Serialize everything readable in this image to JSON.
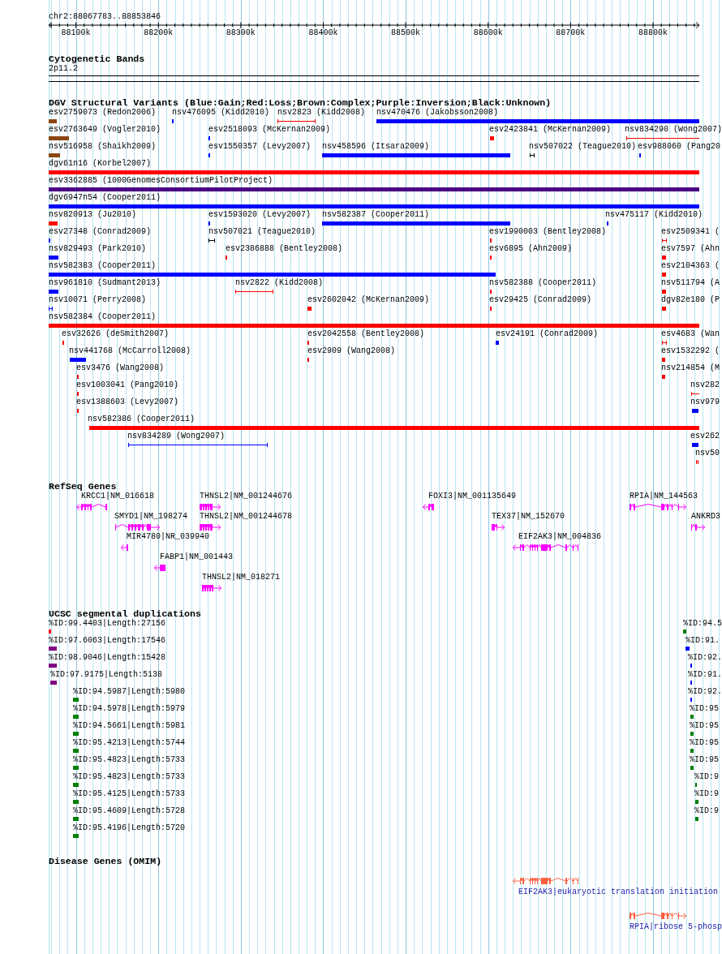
{
  "ruler": {
    "region": "chr2:88067783..88853846",
    "ticks": [
      "88100k",
      "88200k",
      "88300k",
      "88400k",
      "88500k",
      "88600k",
      "88700k",
      "88800k"
    ]
  },
  "tracks": [
    {
      "kind": "cytoband",
      "title": "Cytogenetic Bands",
      "bands": [
        {
          "label": "2p11.2"
        }
      ]
    },
    {
      "kind": "variants",
      "title": "DGV Structural Variants (Blue:Gain;Red:Loss;Brown:Complex;Purple:Inversion;Black:Unknown)",
      "features": [
        {
          "label": "esv2759073 (Redon2006)",
          "kind": "bar",
          "color": "#8b4513"
        },
        {
          "label": "nsv476095 (Kidd2010)",
          "kind": "bar",
          "color": "#0000ff"
        },
        {
          "label": "nsv2823 (Kidd2008)",
          "kind": "span",
          "color": "#ff0000"
        },
        {
          "label": "nsv470476 (Jakobsson2008)",
          "kind": "bar",
          "color": "#0000ff"
        },
        {
          "label": "esv2763649 (Vogler2010)",
          "kind": "bar",
          "color": "#8b4513"
        },
        {
          "label": "esv2518093 (McKernan2009)",
          "kind": "bar",
          "color": "#0000ff"
        },
        {
          "label": "esv2423841 (McKernan2009)",
          "kind": "bar",
          "color": "#ff0000"
        },
        {
          "label": "nsv834290 (Wong2007)",
          "kind": "span",
          "color": "#ff0000"
        },
        {
          "label": "nsv516958 (Shaikh2009)",
          "kind": "bar",
          "color": "#8b4513"
        },
        {
          "label": "esv1550357 (Levy2007)",
          "kind": "bar",
          "color": "#0000ff"
        },
        {
          "label": "nsv458596 (Itsara2009)",
          "kind": "bar",
          "color": "#0000ff"
        },
        {
          "label": "nsv507022 (Teague2010)",
          "kind": "span",
          "color": "#000000"
        },
        {
          "label": "esv988060 (Pang20",
          "kind": "bar",
          "color": "#0000ff"
        },
        {
          "label": "dgv61n16 (Korbel2007)",
          "kind": "bar",
          "color": "#ff0000"
        },
        {
          "label": "esv3362885 (1000GenomesConsortiumPilotProject)",
          "kind": "bar",
          "color": "#4b0082"
        },
        {
          "label": "dgv6947n54 (Cooper2011)",
          "kind": "bar",
          "color": "#0000ff"
        },
        {
          "label": "nsv820913 (Ju2010)",
          "kind": "bar",
          "color": "#ff0000"
        },
        {
          "label": "esv1593020 (Levy2007)",
          "kind": "bar",
          "color": "#0000ff"
        },
        {
          "label": "nsv582387 (Cooper2011)",
          "kind": "bar",
          "color": "#0000ff"
        },
        {
          "label": "nsv475117 (Kidd2010)",
          "kind": "bar",
          "color": "#0000ff"
        },
        {
          "label": "esv27348 (Conrad2009)",
          "kind": "bar",
          "color": "#0000ff"
        },
        {
          "label": "nsv507021 (Teague2010)",
          "kind": "span",
          "color": "#000000"
        },
        {
          "label": "esv1990003 (Bentley2008)",
          "kind": "bar",
          "color": "#ff0000"
        },
        {
          "label": "esv2509341 (",
          "kind": "span",
          "color": "#ff0000"
        },
        {
          "label": "nsv829493 (Park2010)",
          "kind": "bar",
          "color": "#0000ff"
        },
        {
          "label": "esv2386888 (Bentley2008)",
          "kind": "bar",
          "color": "#ff0000"
        },
        {
          "label": "esv6895 (Ahn2009)",
          "kind": "bar",
          "color": "#ff0000"
        },
        {
          "label": "esv7597 (Ahn",
          "kind": "bar",
          "color": "#ff0000"
        },
        {
          "label": "nsv582383 (Cooper2011)",
          "kind": "bar",
          "color": "#0000ff"
        },
        {
          "label": "esv2104363 (",
          "kind": "bar",
          "color": "#ff0000"
        },
        {
          "label": "nsv961810 (Sudmant2013)",
          "kind": "bar",
          "color": "#0000ff"
        },
        {
          "label": "nsv2822 (Kidd2008)",
          "kind": "span",
          "color": "#ff0000"
        },
        {
          "label": "nsv582388 (Cooper2011)",
          "kind": "bar",
          "color": "#ff0000"
        },
        {
          "label": "nsv511794 (A",
          "kind": "bar",
          "color": "#ff0000"
        },
        {
          "label": "nsv10071 (Perry2008)",
          "kind": "span",
          "color": "#0000ff"
        },
        {
          "label": "esv2602042 (McKernan2009)",
          "kind": "bar",
          "color": "#ff0000"
        },
        {
          "label": "esv29425 (Conrad2009)",
          "kind": "bar",
          "color": "#ff0000"
        },
        {
          "label": "dgv82e180 (P",
          "kind": "bar",
          "color": "#ff0000"
        },
        {
          "label": "nsv582384 (Cooper2011)",
          "kind": "bar",
          "color": "#ff0000"
        },
        {
          "label": "esv32626 (deSmith2007)",
          "kind": "bar",
          "color": "#ff0000"
        },
        {
          "label": "esv2042558 (Bentley2008)",
          "kind": "bar",
          "color": "#ff0000"
        },
        {
          "label": "esv24191 (Conrad2009)",
          "kind": "bar",
          "color": "#0000ff"
        },
        {
          "label": "esv4683 (Wan",
          "kind": "span",
          "color": "#ff0000"
        },
        {
          "label": "nsv441768 (McCarroll2008)",
          "kind": "bar",
          "color": "#0000ff"
        },
        {
          "label": "esv2909 (Wang2008)",
          "kind": "bar",
          "color": "#ff0000"
        },
        {
          "label": "esv1532292 (",
          "kind": "bar",
          "color": "#ff0000"
        },
        {
          "label": "esv3476 (Wang2008)",
          "kind": "bar",
          "color": "#ff0000"
        },
        {
          "label": "nsv214854 (M",
          "kind": "bar",
          "color": "#ff0000"
        },
        {
          "label": "esv1003041 (Pang2010)",
          "kind": "bar",
          "color": "#ff0000"
        },
        {
          "label": "nsv282",
          "kind": "span",
          "color": "#ff0000"
        },
        {
          "label": "esv1388603 (Levy2007)",
          "kind": "bar",
          "color": "#ff0000"
        },
        {
          "label": "nsv979",
          "kind": "bar",
          "color": "#0000ff"
        },
        {
          "label": "nsv582386 (Cooper2011)",
          "kind": "bar",
          "color": "#ff0000"
        },
        {
          "label": "nsv834289 (Wong2007)",
          "kind": "span",
          "color": "#0000ff"
        },
        {
          "label": "esv262",
          "kind": "bar",
          "color": "#0000ff"
        },
        {
          "label": "nsv50",
          "kind": "span",
          "color": "#ff0000"
        }
      ]
    },
    {
      "kind": "genes",
      "title": "RefSeq Genes",
      "features": [
        {
          "label": "KRCC1|NM_016618",
          "reverse": true
        },
        {
          "label": "THNSL2|NM_001244676",
          "reverse": false
        },
        {
          "label": "FOXI3|NM_001135649",
          "reverse": true
        },
        {
          "label": "RPIA|NM_144563",
          "reverse": false
        },
        {
          "label": "SMYD1|NM_198274",
          "reverse": false
        },
        {
          "label": "THNSL2|NM_001244678",
          "reverse": false
        },
        {
          "label": "TEX37|NM_152670",
          "reverse": false
        },
        {
          "label": "ANKRD3",
          "reverse": false
        },
        {
          "label": "MIR4780|NR_039940",
          "reverse": true
        },
        {
          "label": "EIF2AK3|NM_004836",
          "reverse": true
        },
        {
          "label": "FABP1|NM_001443",
          "reverse": true
        },
        {
          "label": "THNSL2|NM_018271",
          "reverse": false
        }
      ]
    },
    {
      "kind": "duplications",
      "title": "UCSC segmental duplications",
      "features": [
        {
          "label": "%ID:99.4403|Length:27156",
          "color": "#ff0000"
        },
        {
          "label": "%ID:94.5",
          "color": "#008000"
        },
        {
          "label": "%ID:97.6063|Length:17546",
          "color": "#800080"
        },
        {
          "label": "%ID:91.",
          "color": "#0000ff"
        },
        {
          "label": "%ID:98.9046|Length:15428",
          "color": "#800080"
        },
        {
          "label": "%ID:92.",
          "color": "#0000ff"
        },
        {
          "label": "%ID:97.9175|Length:5138",
          "color": "#800080"
        },
        {
          "label": "%ID:91.",
          "color": "#0000ff"
        },
        {
          "label": "%ID:94.5987|Length:5980",
          "color": "#008000"
        },
        {
          "label": "%ID:92.",
          "color": "#0000ff"
        },
        {
          "label": "%ID:94.5978|Length:5979",
          "color": "#008000"
        },
        {
          "label": "%ID:95",
          "color": "#008000"
        },
        {
          "label": "%ID:94.5661|Length:5981",
          "color": "#008000"
        },
        {
          "label": "%ID:95",
          "color": "#008000"
        },
        {
          "label": "%ID:95.4213|Length:5744",
          "color": "#008000"
        },
        {
          "label": "%ID:95",
          "color": "#008000"
        },
        {
          "label": "%ID:95.4823|Length:5733",
          "color": "#008000"
        },
        {
          "label": "%ID:95",
          "color": "#008000"
        },
        {
          "label": "%ID:95.4823|Length:5733",
          "color": "#008000"
        },
        {
          "label": "%ID:9",
          "color": "#008000"
        },
        {
          "label": "%ID:95.4125|Length:5733",
          "color": "#008000"
        },
        {
          "label": "%ID:9",
          "color": "#008000"
        },
        {
          "label": "%ID:95.4609|Length:5728",
          "color": "#008000"
        },
        {
          "label": "%ID:9",
          "color": "#008000"
        },
        {
          "label": "%ID:95.4196|Length:5720",
          "color": "#008000"
        }
      ]
    },
    {
      "kind": "disease",
      "title": "Disease Genes (OMIM)",
      "features": [
        {
          "label": "EIF2AK3|eukaryotic translation initiation",
          "reverse": true
        },
        {
          "label": "RPIA|ribose 5-phosp",
          "reverse": false
        }
      ]
    }
  ]
}
